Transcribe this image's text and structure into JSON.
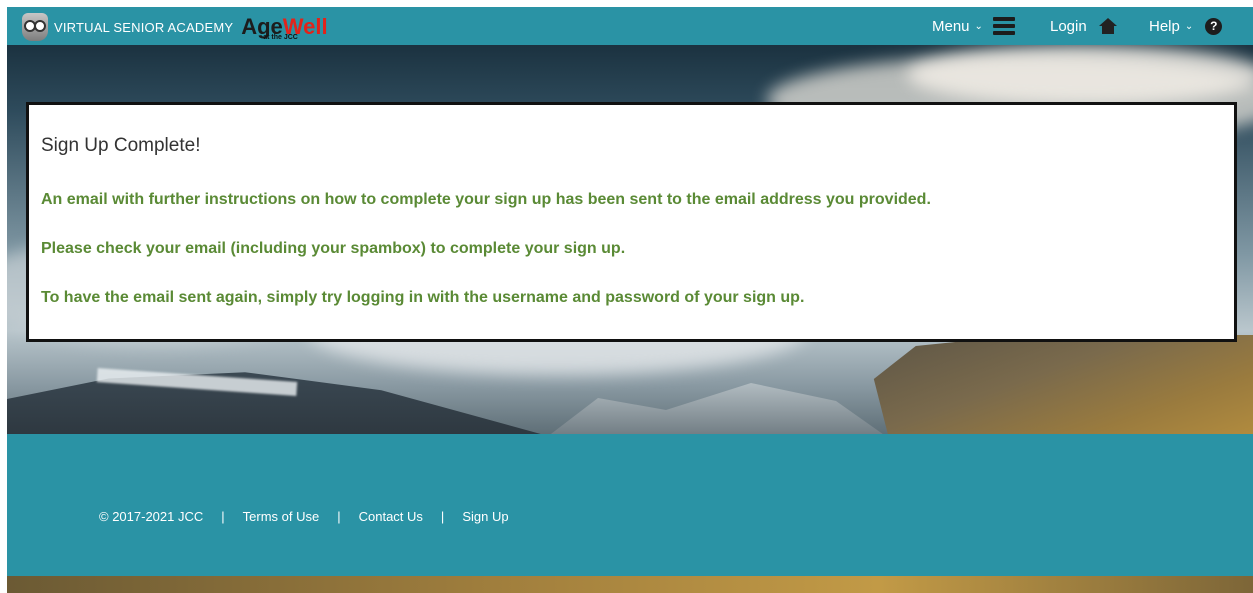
{
  "header": {
    "brand_text": "VIRTUAL SENIOR ACADEMY",
    "logo_age": "Age",
    "logo_well": "Well",
    "logo_sub": "at the JCC",
    "menu_label": "Menu",
    "login_label": "Login",
    "help_label": "Help",
    "help_icon_glyph": "?"
  },
  "main": {
    "title": "Sign Up Complete!",
    "messages": [
      "An email with further instructions on how to complete your sign up has been sent to the email address you provided.",
      "Please check your email (including your spambox) to complete your sign up.",
      "To have the email sent again, simply try logging in with the username and password of your sign up."
    ]
  },
  "footer": {
    "copyright": "© 2017-2021 JCC",
    "separator": "|",
    "links": [
      "Terms of Use",
      "Contact Us",
      "Sign Up"
    ]
  },
  "colors": {
    "bar_teal": "#2a93a5",
    "message_green": "#5a8a35",
    "logo_red": "#e2231a"
  },
  "icons": [
    "owl-logo-icon",
    "hamburger-icon",
    "home-icon",
    "help-icon",
    "chevron-down-icon"
  ]
}
